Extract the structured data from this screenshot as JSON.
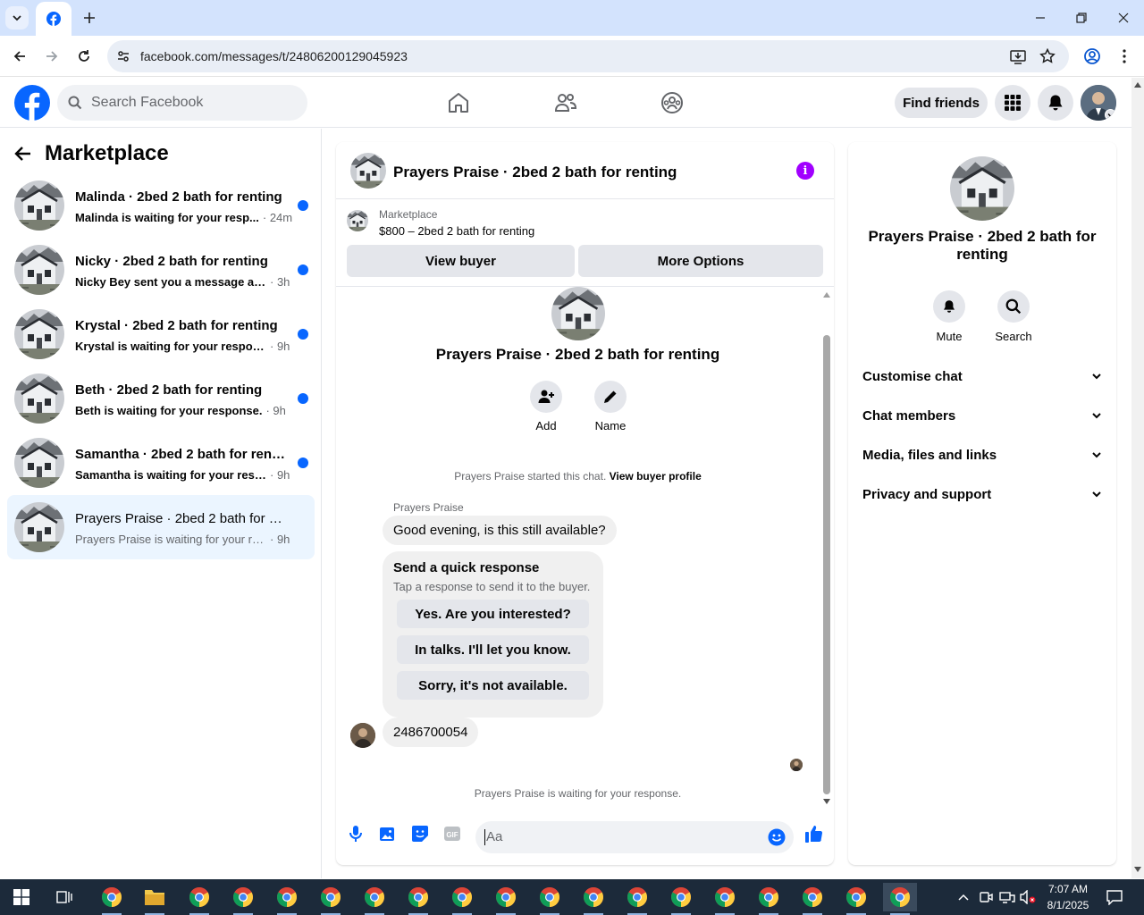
{
  "browser": {
    "url": "facebook.com/messages/t/24806200129045923"
  },
  "fb": {
    "search_placeholder": "Search Facebook",
    "find_friends": "Find friends"
  },
  "left": {
    "title": "Marketplace",
    "conversations": [
      {
        "title": "Malinda · 2bed 2 bath for renting",
        "text": "Malinda is waiting for your resp...",
        "time": "· 24m",
        "unread": true
      },
      {
        "title": "Nicky · 2bed 2 bath for renting",
        "text": "Nicky Bey sent you a message abo...",
        "time": "· 3h",
        "unread": true
      },
      {
        "title": "Krystal · 2bed 2 bath for renting",
        "text": "Krystal is waiting for your response.",
        "time": "· 9h",
        "unread": true
      },
      {
        "title": "Beth · 2bed 2 bath for renting",
        "text": "Beth is waiting for your response.",
        "time": "· 9h",
        "unread": true
      },
      {
        "title": "Samantha · 2bed 2 bath for renti...",
        "text": "Samantha is waiting for your resp...",
        "time": "· 9h",
        "unread": true
      },
      {
        "title": "Prayers Praise · 2bed 2 bath for re...",
        "text": "Prayers Praise is waiting for your resp...",
        "time": "· 9h",
        "unread": false
      }
    ]
  },
  "chat": {
    "title": "Prayers Praise · 2bed 2 bath for renting",
    "marketplace_label": "Marketplace",
    "listing": "$800 – 2bed 2 bath for renting",
    "view_buyer": "View buyer",
    "more_options": "More Options",
    "intro_title": "Prayers Praise · 2bed 2 bath for renting",
    "add_label": "Add",
    "name_label": "Name",
    "started_text": "Prayers Praise started this chat.",
    "view_profile": "View buyer profile",
    "sender": "Prayers Praise",
    "message1": "Good evening, is this still available?",
    "quick_title": "Send a quick response",
    "quick_sub": "Tap a response to send it to the buyer.",
    "quick_options": [
      "Yes. Are you interested?",
      "In talks. I'll let you know.",
      "Sorry, it's not available."
    ],
    "message2": "2486700054",
    "waiting": "Prayers Praise is waiting for your response.",
    "composer_placeholder": "Aa"
  },
  "right": {
    "title": "Prayers Praise · 2bed 2 bath for renting",
    "mute": "Mute",
    "search": "Search",
    "sections": [
      "Customise chat",
      "Chat members",
      "Media, files and links",
      "Privacy and support"
    ]
  },
  "taskbar": {
    "time": "7:07 AM",
    "date": "8/1/2025"
  },
  "colors": {
    "fb_blue": "#0866ff",
    "info_purple": "#a100ff",
    "chrome_tab_bg": "#d3e3fd"
  }
}
